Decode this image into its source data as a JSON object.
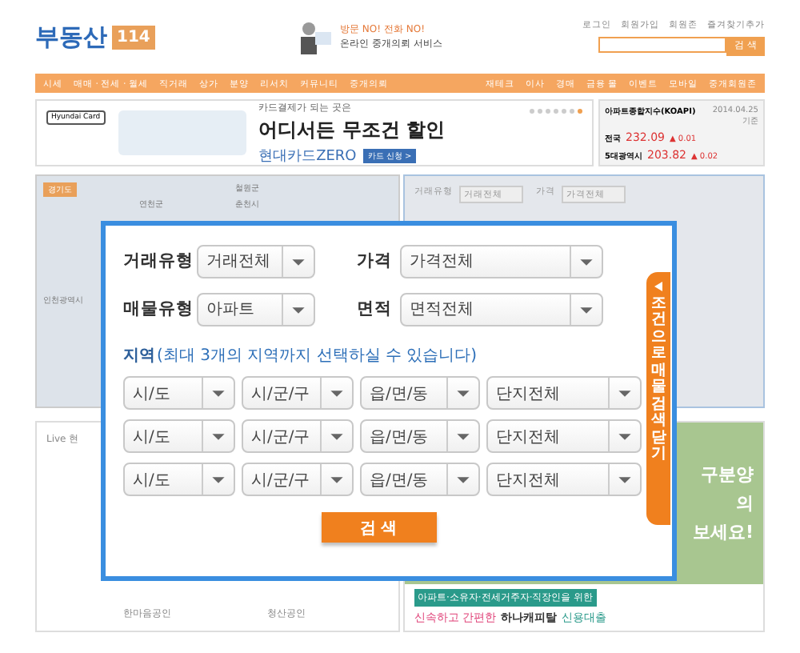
{
  "header": {
    "logo": {
      "text": "부동산",
      "badge": "114"
    },
    "promo": {
      "kicker": "방문 NO! 전화 NO!",
      "title": "온라인 중개의뢰 서비스"
    },
    "links": [
      "로그인",
      "회원가입",
      "회원존",
      "즐겨찾기추가"
    ],
    "search": {
      "button": "검 색"
    }
  },
  "nav": {
    "left": [
      "시세",
      "매매 · 전세 · 월세",
      "직거래",
      "상가",
      "분양",
      "리서치",
      "커뮤니티",
      "중개의뢰"
    ],
    "right": [
      "재테크",
      "이사",
      "경매",
      "금융 몰",
      "이벤트",
      "모바일",
      "중개회원존"
    ]
  },
  "banner": {
    "brand": "Hyundai Card",
    "kicker": "카드결제가 되는 곳은",
    "headline": "어디서든 무조건 할인",
    "product": "현대카드ZERO",
    "cta": "카드 신청 >",
    "slides": [
      {
        "selected": false
      },
      {
        "selected": false
      },
      {
        "selected": false
      },
      {
        "selected": false
      },
      {
        "selected": false
      },
      {
        "selected": false
      },
      {
        "selected": true
      }
    ]
  },
  "index_panel": {
    "title": "아파트종합지수(KOAPI)",
    "date": "2014.04.25 기준",
    "rows": [
      {
        "region": "전국",
        "value": "232.09",
        "change": "▲ 0.01"
      },
      {
        "region": "5대광역시",
        "value": "203.82",
        "change": "▲ 0.02"
      }
    ]
  },
  "map": {
    "region_badge": "경기도",
    "labels": [
      "철원군",
      "연천군",
      "춘천시",
      "인천광역시"
    ]
  },
  "background_form": {
    "fields": [
      {
        "label": "거래유형",
        "value": "거래전체"
      },
      {
        "label": "가격",
        "value": "가격전체"
      }
    ]
  },
  "live": {
    "title": "Live 현",
    "agents": [
      "한마음공인",
      "청산공인"
    ]
  },
  "ad": {
    "fragments": [
      "구분양",
      "의",
      "보세요!"
    ],
    "tagline": "아파트·소유자·전세거주자·직장인을 위한",
    "slogan": "신속하고 간편한",
    "brand": "하나캐피탈",
    "product": "신용대출"
  },
  "popup": {
    "filters": [
      [
        {
          "label": "거래유형",
          "value": "거래전체"
        },
        {
          "label": "가격",
          "value": "가격전체"
        }
      ],
      [
        {
          "label": "매물유형",
          "value": "아파트"
        },
        {
          "label": "면적",
          "value": "면적전체"
        }
      ]
    ],
    "region": {
      "label": "지역",
      "note": "(최대 3개의 지역까지 선택하실 수 있습니다)"
    },
    "region_rows": [
      [
        "시/도",
        "시/군/구",
        "읍/면/동",
        "단지전체"
      ],
      [
        "시/도",
        "시/군/구",
        "읍/면/동",
        "단지전체"
      ],
      [
        "시/도",
        "시/군/구",
        "읍/면/동",
        "단지전체"
      ]
    ],
    "search_button": "검 색",
    "side_tab": "조건으로 매물검색 닫기"
  }
}
